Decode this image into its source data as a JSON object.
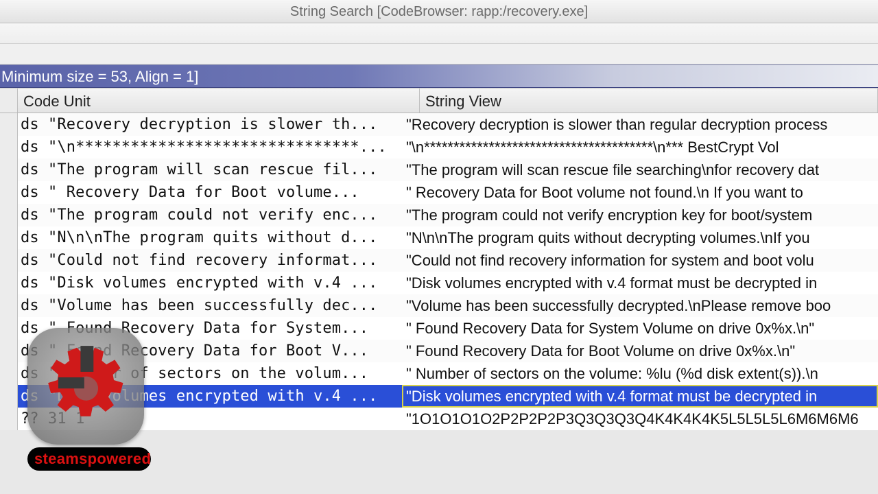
{
  "window": {
    "title": "String Search [CodeBrowser: rapp:/recovery.exe]"
  },
  "paramBar": {
    "text": "Minimum size = 53, Align = 1]"
  },
  "columns": {
    "codeUnit": "Code Unit",
    "stringView": "String View"
  },
  "rows": [
    {
      "cu": "ds \"Recovery decryption is slower th...",
      "sv": "\"Recovery decryption is slower than regular decryption process"
    },
    {
      "cu": "ds \"\\n*******************************...",
      "sv": "\"\\n***************************************\\n***   BestCrypt Vol"
    },
    {
      "cu": "ds \"The program will scan rescue fil...",
      "sv": "\"The program will scan rescue file searching\\nfor recovery dat"
    },
    {
      "cu": "ds \"   Recovery Data for Boot volume...",
      "sv": "\"   Recovery Data for Boot volume not found.\\n   If you want to"
    },
    {
      "cu": "ds \"The program could not verify enc...",
      "sv": "\"The program could not verify encryption key for boot/system"
    },
    {
      "cu": "ds \"N\\n\\nThe program quits without d...",
      "sv": "\"N\\n\\nThe program quits without decrypting volumes.\\nIf you"
    },
    {
      "cu": "ds \"Could not find recovery informat...",
      "sv": "\"Could not find recovery information for system and boot volu"
    },
    {
      "cu": "ds \"Disk volumes encrypted with v.4 ...",
      "sv": "\"Disk volumes encrypted with v.4 format must be decrypted in"
    },
    {
      "cu": "ds \"Volume has been successfully dec...",
      "sv": "\"Volume has been successfully decrypted.\\nPlease remove boo"
    },
    {
      "cu": "ds \" Found Recovery Data for System...",
      "sv": "\" Found Recovery Data for System Volume on drive 0x%x.\\n\""
    },
    {
      "cu": "ds \" Found Recovery Data for Boot V...",
      "sv": "\" Found Recovery Data for Boot Volume on drive 0x%x.\\n\""
    },
    {
      "cu": "ds \" Number of sectors on the volum...",
      "sv": "\" Number of sectors on the volume: %lu (%d disk extent(s)).\\n"
    },
    {
      "cu": "ds \"Disk volumes encrypted with v.4 ...",
      "sv": "\"Disk volumes encrypted with v.4 format must be decrypted in",
      "selected": true
    },
    {
      "cu": "?? 31        1",
      "sv": "\"1O1O1O1O2P2P2P2P3Q3Q3Q3Q4K4K4K4K5L5L5L5L6M6M6M6"
    }
  ],
  "overlay": {
    "label": "steamspowered"
  }
}
